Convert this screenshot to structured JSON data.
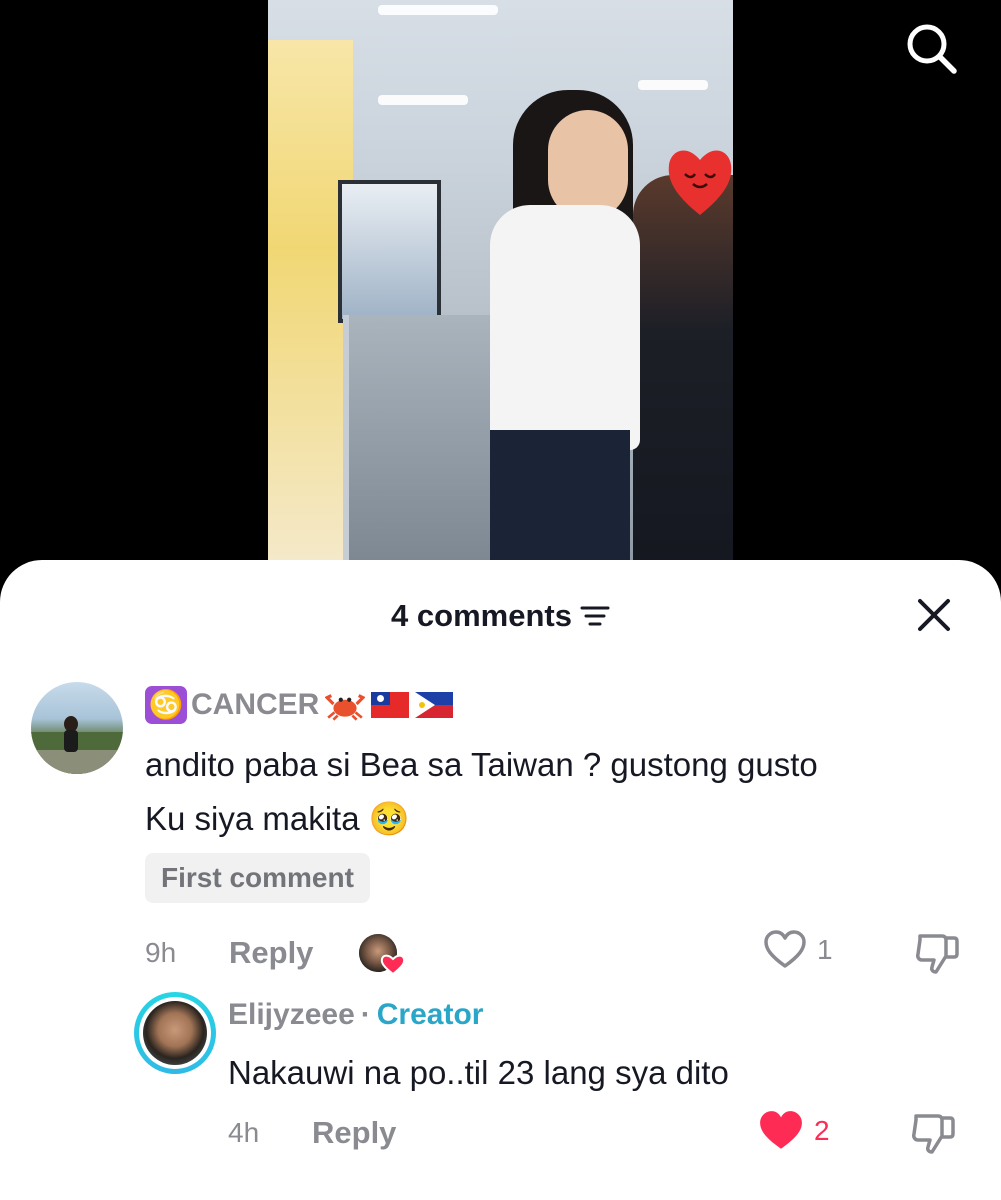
{
  "video": {
    "search_icon": "search-icon"
  },
  "comments_sheet": {
    "count_label": "4 comments",
    "sort_icon": "filter-lines-icon",
    "close_icon": "close-icon",
    "comment": {
      "username": "CANCER",
      "zodiac_glyph": "♋",
      "text_line1": "andito paba si Bea sa Taiwan ? gustong gusto",
      "text_line2": "Ku siya makita 🥹",
      "badge": "First comment",
      "time": "9h",
      "reply_label": "Reply",
      "like_count": "1",
      "liked": false
    },
    "reply": {
      "username": "Elijyzeee",
      "separator": "·",
      "role": "Creator",
      "text": "Nakauwi na po..til 23 lang sya dito",
      "time": "4h",
      "reply_label": "Reply",
      "like_count": "2",
      "liked": true
    },
    "colors": {
      "like_red": "#fe2c55",
      "creator_blue": "#2aa6c9",
      "muted_gray": "#8a8b91",
      "text_dark": "#161823"
    }
  }
}
